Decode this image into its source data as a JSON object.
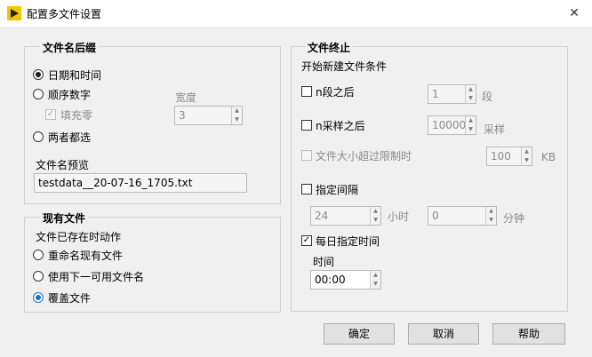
{
  "window": {
    "title": "配置多文件设置",
    "close_glyph": "✕"
  },
  "filename_suffix": {
    "legend": "文件名后缀",
    "opt_datetime": "日期和时间",
    "opt_sequence": "顺序数字",
    "fill_zero": "填充零",
    "opt_both": "两者都选",
    "width_label": "宽度",
    "width_value": "3",
    "preview_label": "文件名预览",
    "preview_value": "testdata__20-07-16_1705.txt"
  },
  "existing_file": {
    "legend": "现有文件",
    "action_label": "文件已存在时动作",
    "opt_rename": "重命名现有文件",
    "opt_next": "使用下一可用文件名",
    "opt_overwrite": "覆盖文件"
  },
  "file_end": {
    "legend": "文件终止",
    "condition_label": "开始新建文件条件",
    "after_segments": "n段之后",
    "segments_value": "1",
    "segments_unit": "段",
    "after_samples": "n采样之后",
    "samples_value": "10000",
    "samples_unit": "采样",
    "size_exceeds": "文件大小超过限制时",
    "size_value": "100",
    "size_unit": "KB",
    "interval": "指定间隔",
    "hours_value": "24",
    "hours_unit": "小时",
    "minutes_value": "0",
    "minutes_unit": "分钟",
    "daily_time": "每日指定时间",
    "time_label": "时间",
    "time_value": "00:00",
    "check_glyph": "✓"
  },
  "buttons": {
    "ok": "确定",
    "cancel": "取消",
    "help": "帮助"
  },
  "colors": {
    "accent": "#1a73d1",
    "icon_bg": "#f5c400"
  }
}
